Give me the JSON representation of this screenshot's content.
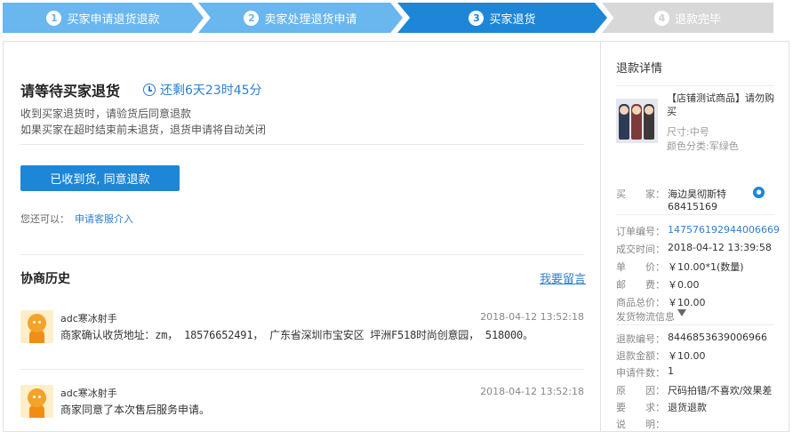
{
  "steps": [
    {
      "num": "1",
      "label": "买家申请退货退款"
    },
    {
      "num": "2",
      "label": "卖家处理退货申请"
    },
    {
      "num": "3",
      "label": "买家退货"
    },
    {
      "num": "4",
      "label": "退款完毕"
    }
  ],
  "status": {
    "title": "请等待买家退货",
    "countdown": "还剩6天23时45分",
    "desc1": "收到买家退货时，请验货后同意退款",
    "desc2": "如果买家在超时结束前未退货，退货申请将自动关闭"
  },
  "actions": {
    "agree_button": "已收到货, 同意退款",
    "also_label": "您还可以：",
    "service_link": "申请客服介入"
  },
  "history": {
    "title": "协商历史",
    "leave_message": "我要留言",
    "messages": [
      {
        "name": "adc寒冰射手",
        "time": "2018-04-12 13:52:18",
        "text": "商家确认收货地址：zm， 18576652491， 广东省深圳市宝安区 坪洲F518时尚创意园， 518000。"
      },
      {
        "name": "adc寒冰射手",
        "time": "2018-04-12 13:52:18",
        "text": "商家同意了本次售后服务申请。"
      }
    ]
  },
  "detail": {
    "title": "退款详情",
    "product": {
      "name": "【店铺测试商品】请勿购买",
      "size": "尺寸:中号",
      "color": "颜色分类:军绿色"
    },
    "buyer_label": "买　　家：",
    "buyer_name": "海边昊彻斯特",
    "buyer_id": "68415169",
    "order_rows": [
      {
        "k": "订单编号：",
        "v": "1475761929440066​69"
      },
      {
        "k": "成交时间：",
        "v": "2018-04-12 13:39:58"
      },
      {
        "k": "单　　价：",
        "v": "￥10.00*1(数量)"
      },
      {
        "k": "邮　　费：",
        "v": "￥0.00"
      },
      {
        "k": "商品总价：",
        "v": "￥10.00"
      }
    ],
    "logistics": "发货物流信息",
    "refund_rows": [
      {
        "k": "退款编号：",
        "v": "8446853639006966"
      },
      {
        "k": "退款金额：",
        "v": "￥10.00"
      },
      {
        "k": "申请件数：",
        "v": "1"
      },
      {
        "k": "原　　因：",
        "v": "尺码拍错/不喜欢/效果差"
      },
      {
        "k": "要　　求：",
        "v": "退货退款"
      },
      {
        "k": "说　　明：",
        "v": ""
      }
    ]
  }
}
